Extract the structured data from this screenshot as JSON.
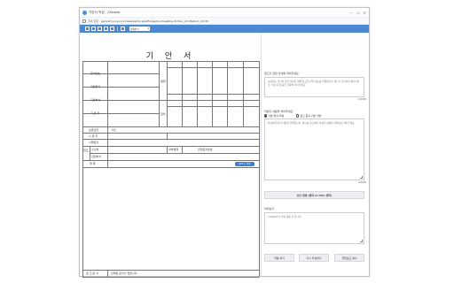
{
  "window": {
    "title": "기안서 작성 - Chrome",
    "controls": [
      "—",
      "☐",
      "✕"
    ]
  },
  "address": {
    "warning": "주의 요함",
    "url": "gw.bizmyung.co.kr/eap/ea/docpop/EAAppDocViewPop.do?doc_id=7&form_id=30"
  },
  "toolbar": {
    "icons": [
      "new-doc-icon",
      "print-icon",
      "save-icon",
      "layout-icon",
      "template-icon",
      "settings-icon"
    ],
    "select_value": "결재방식"
  },
  "doc": {
    "title": "기 안 서",
    "labels": {
      "doc_number": "문서번호",
      "written_date": "작성일자",
      "department": "기안부서",
      "drafter": "기 안 자",
      "retention": "보존년한",
      "retention_value": "5년",
      "viewer": "시 행 자",
      "executor": "시행일자",
      "reference": "참조",
      "cooperation_label": "협조",
      "external_dept": "수신처",
      "external_value": "내부결재",
      "approval_line": "결재",
      "agreement_line": "합의",
      "subject": "제    목",
      "section_coop": "협조",
      "related_dept": "관련부서",
      "related_number": "관련문서번호",
      "gpt_button": "GPT도 작성",
      "footer_label": "참 조 문 서",
      "footer_value": "선택된 문서가 없습니다."
    }
  },
  "assistant": {
    "section1_title": "참고할 관련 안내를 적어주세요.",
    "section1_placeholder": "사용자는 기안서 초안 작성을 위해 참고할 관련 정보를 입력합니다. 예: 이 기안서의 목적, 배경, 필요 사항 등을 간략히 적어주세요.",
    "section1_counter": "0/4000",
    "section2_title": "작성할 내용을 적어주세요.",
    "radio1": "기본 양식 작성",
    "radio2": "참고 문서 기반 작성",
    "section2_placeholder": "본문에 들어갈 내용을 입력합니다. 예시를 참고하여 작성할 내용을 자유롭게 적어주세요.",
    "section2_counter": "0/4000",
    "generate_button": "초안 생성 (클릭 or Ctrl+엔터)",
    "preview_title": "미리보기",
    "preview_placeholder": "ChatGPT가 작성 내용 을 입니다.",
    "btn_apply": "적용 하기",
    "btn_retry": "다시 작성하기",
    "btn_copy": "클립보드 복사"
  }
}
